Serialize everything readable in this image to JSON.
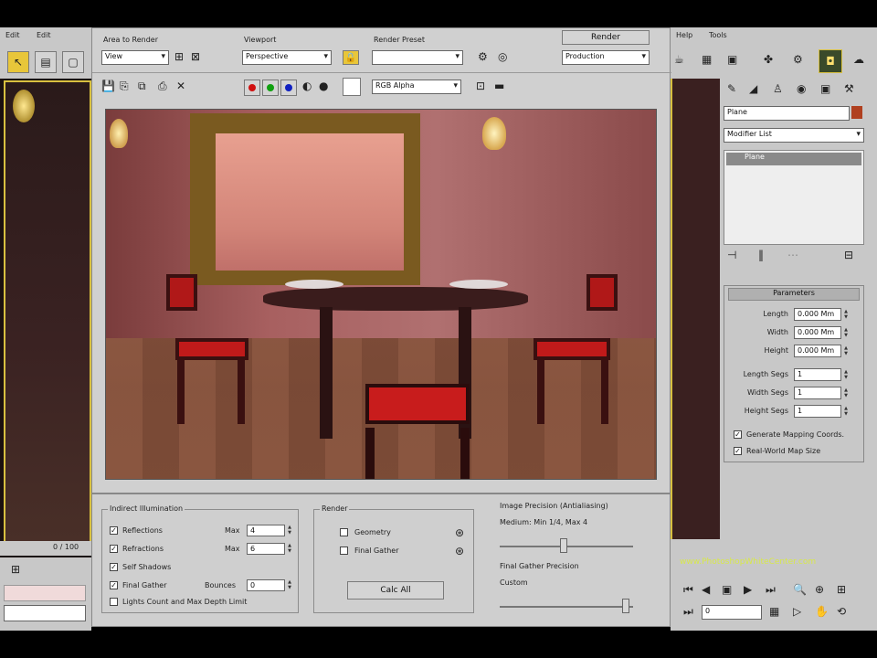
{
  "left_strip": {
    "tabs": [
      "Edit",
      "Edit"
    ],
    "coord_label": "0 / 100"
  },
  "render_window": {
    "area_label": "Area to Render",
    "area_value": "View",
    "viewport_label": "Viewport",
    "viewport_value": "Perspective",
    "preset_label": "Render Preset",
    "preset_value": "",
    "render_button": "Render",
    "production_value": "Production",
    "channel_value": "RGB Alpha"
  },
  "scene": {
    "description_colors": {
      "wall": "#b07070",
      "floor": "#8a5a40",
      "chair": "#b01818",
      "table": "#3a1c1c"
    }
  },
  "right_panel": {
    "menu": [
      "Help",
      "Tools"
    ],
    "object_name": "Plane",
    "modifier_list": "Modifier List",
    "stack_item": "Plane",
    "rollout_title": "Parameters",
    "params": [
      {
        "label": "Length",
        "value": "0.000 Mm"
      },
      {
        "label": "Width",
        "value": "0.000 Mm"
      },
      {
        "label": "Height",
        "value": "0.000 Mm"
      }
    ],
    "segs": [
      {
        "label": "Length Segs",
        "value": "1"
      },
      {
        "label": "Width Segs",
        "value": "1"
      },
      {
        "label": "Height Segs",
        "value": "1"
      }
    ],
    "check_gen": "Generate Mapping Coords.",
    "check_real": "Real-World Map Size"
  },
  "bottom": {
    "render_group_title": "Indirect Illumination",
    "cb1": "Reflections",
    "cb2": "Refractions",
    "cb3": "Self Shadows",
    "cb4": "Final Gather",
    "cb5": "Lights Count and Max Depth Limit",
    "max1_label": "Max",
    "max1_value": "4",
    "max2_label": "Max",
    "max2_value": "6",
    "bounces_label": "Bounces",
    "bounces_value": "0",
    "group2_title": "Render",
    "cb_geom": "Geometry",
    "cb_final": "Final Gather",
    "calc_btn": "Calc All",
    "right_title": "Image Precision (Antialiasing)",
    "right_sub": "Medium: Min 1/4, Max 4",
    "fg_label": "Final Gather Precision",
    "fg_value": "Custom",
    "watermark": "www.PhotoshopWhiteCenter.com",
    "frame_value": "0"
  }
}
